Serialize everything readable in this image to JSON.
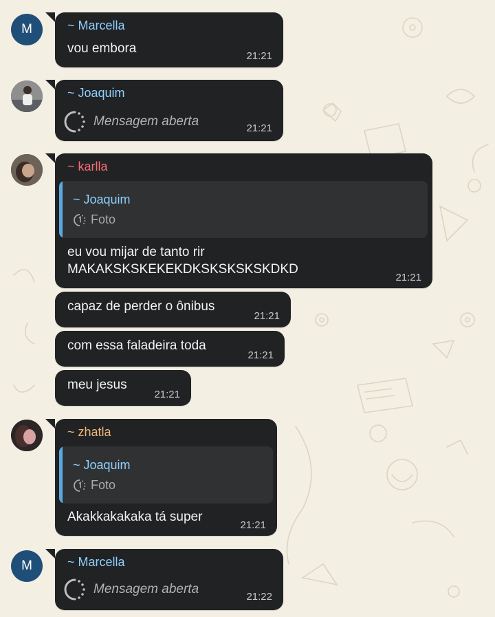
{
  "colors": {
    "wallpaper": "#f4efe3",
    "bubble_bg": "#202224",
    "quote_bg": "#2f3133",
    "quote_bar": "#5aa9e0",
    "message_text": "#f2f2f2",
    "timestamp": "#c9c9c9"
  },
  "messages": [
    {
      "sender": "~ Marcella",
      "sender_color": "#8fd0ff",
      "avatar": "M",
      "text": "vou embora",
      "time": "21:21"
    },
    {
      "sender": "~ Joaquim",
      "sender_color": "#8fd0ff",
      "avatar_icon": "profile-photo",
      "status": "Mensagem aberta",
      "status_icon": "view-once-icon",
      "time": "21:21"
    },
    {
      "sender": "~ karlla",
      "sender_color": "#ff6b73",
      "avatar_icon": "profile-photo",
      "quote": {
        "sender": "~ Joaquim",
        "media_icon": "view-once-icon",
        "media": "Foto"
      },
      "text": "eu vou mijar de tanto rir\nMAKAKSKSKEKEKDKSKSKSKSKDKD",
      "time": "21:21"
    },
    {
      "text": "capaz de perder o ônibus",
      "time": "21:21"
    },
    {
      "text": "com essa faladeira toda",
      "time": "21:21"
    },
    {
      "text": "meu jesus",
      "time": "21:21"
    },
    {
      "sender": "~ zhatla",
      "sender_color": "#f3b77a",
      "avatar_icon": "profile-photo",
      "quote": {
        "sender": "~ Joaquim",
        "media_icon": "view-once-icon",
        "media": "Foto"
      },
      "text": "Akakkakakaka tá super",
      "time": "21:21"
    },
    {
      "sender": "~ Marcella",
      "sender_color": "#8fd0ff",
      "avatar": "M",
      "status": "Mensagem aberta",
      "status_icon": "view-once-icon",
      "time": "21:22"
    }
  ]
}
